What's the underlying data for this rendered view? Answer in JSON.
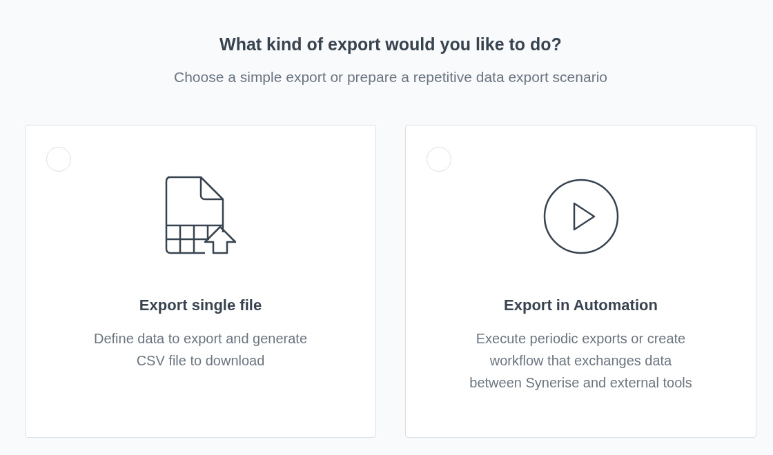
{
  "heading": "What kind of export would you like to do?",
  "subheading": "Choose a simple export or prepare a repetitive data export scenario",
  "options": [
    {
      "kind": "file",
      "title": "Export single file",
      "description": "Define data to export and generate CSV file to download",
      "selected": false
    },
    {
      "kind": "automation",
      "title": "Export in Automation",
      "description": "Execute periodic exports or create workflow that exchanges data between Synerise and external tools",
      "selected": false
    }
  ]
}
